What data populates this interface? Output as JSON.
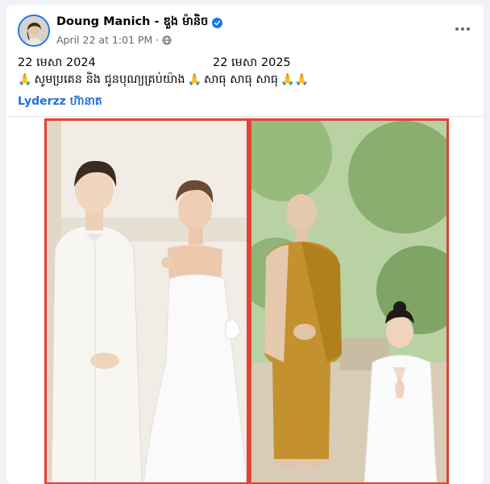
{
  "post": {
    "author_name": "Doung Manich - ឌួង ម៉ានិច",
    "timestamp": "April 22 at 1:01 PM",
    "separator": "·",
    "audience_icon": "globe-icon",
    "more_icon": "more-icon",
    "verified_icon": "verified-badge-icon"
  },
  "content": {
    "date_left": "22 មេសា 2024",
    "date_right": "22 មេសា 2025",
    "body_part1": "សូមប្រគេន និង ជូនបុណ្យគ្រប់យ៉ាង",
    "body_part2": "សាធុ សាធុ សាធុ",
    "tag_name": "Lyderzz",
    "tag_suffix": "ហ៊ានាត"
  },
  "colors": {
    "accent": "#1877f2",
    "frame": "#e34336",
    "link": "#216fdb",
    "muted": "#65676b"
  }
}
